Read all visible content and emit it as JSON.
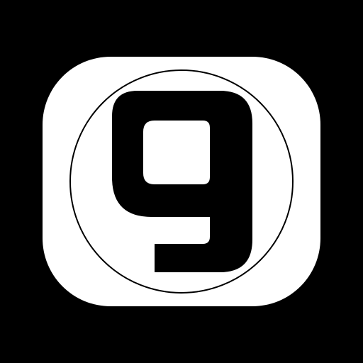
{
  "app_icon": {
    "symbol": "stylized-letter-g-logo",
    "colors": {
      "background": "#000000",
      "tile": "#ffffff",
      "mark": "#000000",
      "ring": "#000000"
    }
  }
}
